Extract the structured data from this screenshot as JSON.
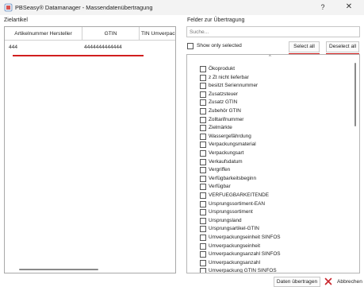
{
  "window": {
    "title": "PBSeasy® Datamanager - Massendatenübertragung",
    "help_label": "?",
    "close_label": "✕"
  },
  "left": {
    "section_label": "Zielartikel",
    "columns": [
      "Artikelnummer Hersteller",
      "GTIN",
      "TIN Umverpack"
    ],
    "rows": [
      {
        "cells": [
          "444",
          "4444444444444"
        ]
      }
    ]
  },
  "right": {
    "section_label": "Felder zur Übertragung",
    "search_placeholder": "Suche...",
    "show_only_selected_label": "Show only selected",
    "select_all_label": "Select all",
    "deselect_all_label": "Deselect all",
    "fields": [
      "Ökoprodukt",
      "z Zt nicht lieferbar",
      "besitzt Seriennummer",
      "Zusatzsteuer",
      "Zusatz GTIN",
      "Zubehör GTIN",
      "Zolltarifnummer",
      "Zielmärkte",
      "Wassergefährdung",
      "Verpackungsmaterial",
      "Verpackungsart",
      "Verkaufsdatum",
      "Vergriffen",
      "Verfügbarkeitsbeginn",
      "Verfügbar",
      "VERFUEGBARKEITENDE",
      "Ursprungssortiment-EAN",
      "Ursprungssortiment",
      "Ursprungsland",
      "Ursprungsartikel-GTIN",
      "Umverpackungseinheit SINFOS",
      "Umverpackungseinheit",
      "Umverpackungsanzahl SINFOS",
      "Umverpackungsanzahl",
      "Umverpackung GTIN SINFOS"
    ]
  },
  "footer": {
    "transfer_label": "Daten übertragen",
    "cancel_label": "Abbrechen"
  },
  "colors": {
    "highlight_red": "#d11f1f",
    "cancel_icon_red": "#c8242b"
  }
}
